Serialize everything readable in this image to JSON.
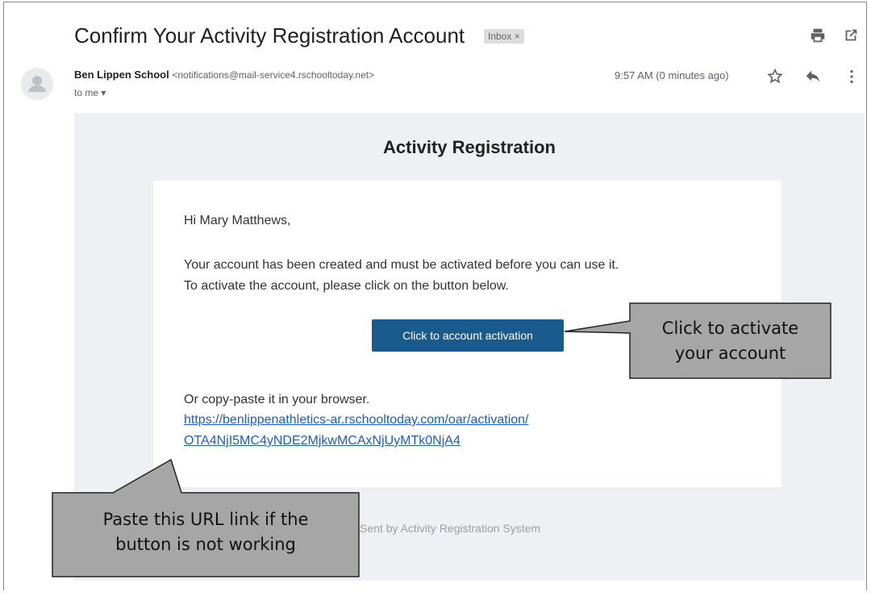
{
  "email": {
    "subject": "Confirm Your Activity Registration Account",
    "label": "Inbox ×",
    "sender_name": "Ben Lippen School",
    "sender_email": "<notifications@mail-service4.rschooltoday.net>",
    "to": "to me ▾",
    "time": "9:57 AM (0 minutes ago)"
  },
  "body": {
    "title": "Activity Registration",
    "greeting": "Hi Mary Matthews,",
    "line1": "Your account has been created and must be activated before you can use it.",
    "line2": "To activate the account, please click on the button below.",
    "button": "Click to account activation",
    "copy_text": "Or copy-paste it in your browser.",
    "url_line1": "https://benlippenathletics-ar.rschooltoday.com/oar/activation/",
    "url_line2": "OTA4NjI5MC4yNDE2MjkwMCAxNjUyMTk0NjA4",
    "footer": "Sent by Activity Registration System"
  },
  "callouts": {
    "button_note_line1": "Click to activate",
    "button_note_line2": "your account",
    "url_note_line1": "Paste this URL link if the",
    "url_note_line2": "button is not working"
  },
  "icons": [
    "print-icon",
    "open-new-window-icon",
    "avatar-icon",
    "star-icon",
    "reply-icon",
    "more-vert-icon"
  ]
}
